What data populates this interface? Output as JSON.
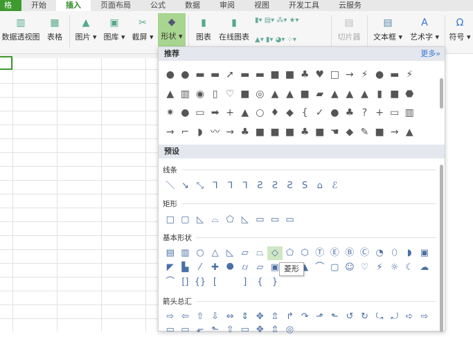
{
  "tabs": [
    "格 ▾",
    "开始",
    "插入",
    "页面布局",
    "公式",
    "数据",
    "审阅",
    "视图",
    "开发工具",
    "云服务"
  ],
  "ribbon": {
    "pivot": "数据透视图",
    "table": "表格",
    "picture": "图片 ▾",
    "gallery": "图库 ▾",
    "screenshot": "截屏 ▾",
    "shapes": "形状 ▾",
    "chart": "图表",
    "online_chart": "在线图表",
    "slicer": "切片器",
    "textbox": "文本框 ▾",
    "wordart": "艺术字 ▾",
    "symbol": "符号 ▾"
  },
  "panel": {
    "recommended": "推荐",
    "more": "更多»",
    "presets": "预设",
    "lines": "线条",
    "rectangles": "矩形",
    "basic_shapes": "基本形状",
    "arrows": "箭头总汇",
    "tooltip": "菱形"
  },
  "shapes": {
    "rec": [
      [
        "●",
        "●",
        "▬",
        "▬",
        "➚",
        "▬",
        "▬",
        "■",
        "■",
        "♣",
        "♥",
        "□",
        "→",
        "⚡",
        "●",
        "▬",
        "⚡"
      ],
      [
        "▲",
        "▥",
        "◉",
        "▯",
        "♡",
        "■",
        "◎",
        "▲",
        "▲",
        "■",
        "▰",
        "▲",
        "▲",
        "▲",
        "▮",
        "■",
        "⬣"
      ],
      [
        "✷",
        "●",
        "▭",
        "➡",
        "+",
        "▲",
        "○",
        "♦",
        "◆",
        "{",
        "✓",
        "●",
        "♣",
        "?",
        "+",
        "▭",
        "▥"
      ],
      [
        "→",
        "⌐",
        "◗",
        "〰",
        "→",
        "♣",
        "■",
        "■",
        "■",
        "♣",
        "■",
        "☚",
        "◆",
        "✎",
        "■",
        "→",
        "▲"
      ]
    ],
    "lines": [
      "＼",
      "↘",
      "⤡",
      "ᒣ",
      "ᒣ",
      "ᒣ",
      "Ƨ",
      "Ƨ",
      "Ƨ",
      "S",
      "⌂",
      "ℰ"
    ],
    "rect": [
      "□",
      "▢",
      "◺",
      "⌓",
      "⬠",
      "◺",
      "▭",
      "▭",
      "▭"
    ],
    "basic1": [
      "▤",
      "▥",
      "○",
      "△",
      "◺",
      "▱",
      "⏢",
      "◇",
      "⬠",
      "⬡",
      "Ⓣ",
      "Ⓔ",
      "Ⓑ",
      "Ⓒ",
      "◔",
      "⬯",
      "◗",
      "▣"
    ],
    "basic2": [
      "◤",
      "▙",
      "⁄",
      "✚",
      "⯃",
      "⌭",
      "▱",
      "▣",
      "",
      "▲",
      "⌒",
      "▢",
      "☺",
      "♡",
      "⚡",
      "☼",
      "☾",
      "☁"
    ],
    "basic3": [
      "⌒",
      "[]",
      "{}",
      "[",
      "",
      "]",
      "{",
      "}"
    ],
    "arrows1": [
      "⇨",
      "⇦",
      "⇧",
      "⇩",
      "⇔",
      "⇕",
      "✥",
      "⇬",
      "↱",
      "↷",
      "⬏",
      "⬑",
      "↺",
      "↻",
      "⤿",
      "⤾",
      "➪",
      "⇨"
    ],
    "arrows2": [
      "▭",
      "▭",
      "⬐",
      "⬑",
      "⇧",
      "▭",
      "✥",
      "⇬",
      "◎"
    ]
  }
}
